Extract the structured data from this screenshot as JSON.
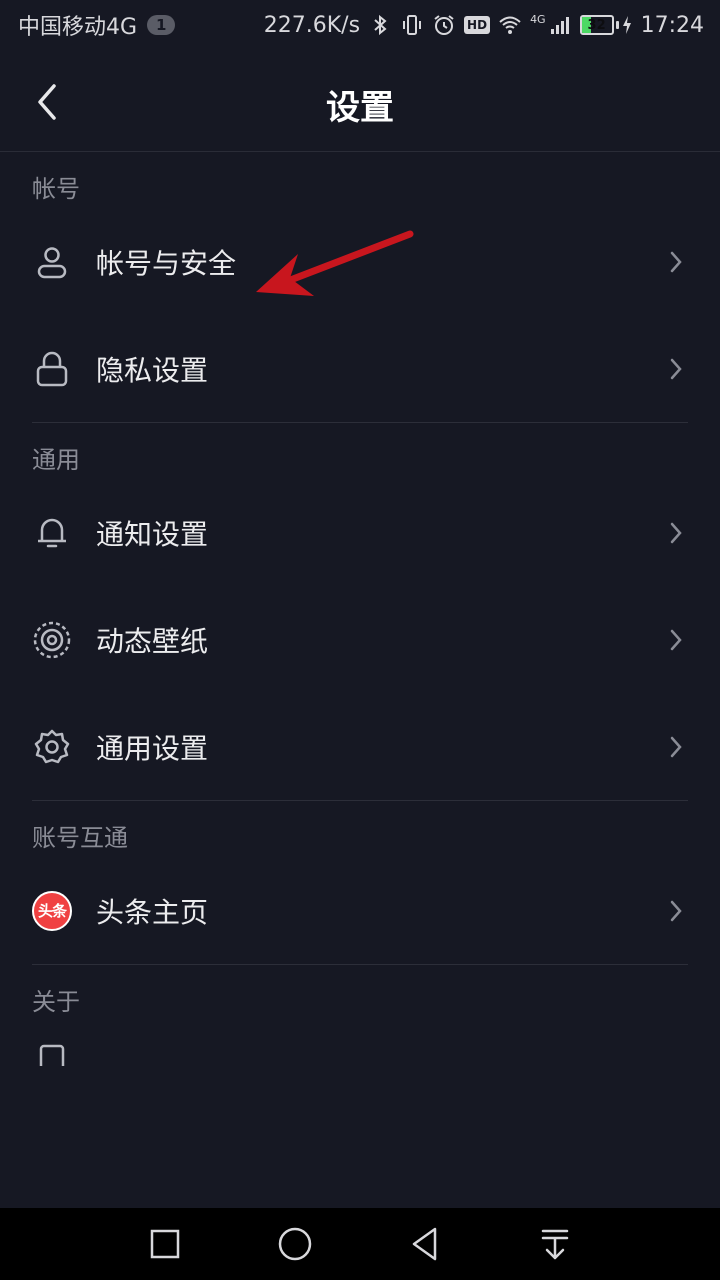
{
  "status_bar": {
    "carrier": "中国移动4G",
    "sim_badge": "1",
    "net_speed": "227.6K/s",
    "hd_label": "HD",
    "signal_label": "4G",
    "battery_level": "32",
    "time": "17:24"
  },
  "header": {
    "title": "设置"
  },
  "sections": {
    "account": {
      "header": "帐号",
      "items": [
        {
          "label": "帐号与安全",
          "icon": "user-icon"
        },
        {
          "label": "隐私设置",
          "icon": "lock-icon"
        }
      ]
    },
    "general": {
      "header": "通用",
      "items": [
        {
          "label": "通知设置",
          "icon": "bell-icon"
        },
        {
          "label": "动态壁纸",
          "icon": "wallpaper-icon"
        },
        {
          "label": "通用设置",
          "icon": "gear-icon"
        }
      ]
    },
    "linked": {
      "header": "账号互通",
      "items": [
        {
          "label": "头条主页",
          "icon": "toutiao-logo",
          "logo_text": "头条"
        }
      ]
    },
    "about": {
      "header": "关于"
    }
  },
  "colors": {
    "background": "#161823",
    "accent_annotation": "#c8161e",
    "toutiao_red": "#f04142",
    "battery_green": "#4cd964"
  }
}
